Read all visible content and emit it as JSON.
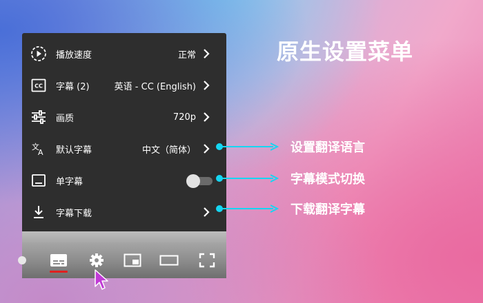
{
  "headline": "原生设置菜单",
  "menu": {
    "items": [
      {
        "icon": "playback-speed-icon",
        "label": "播放速度",
        "value": "正常"
      },
      {
        "icon": "subtitles-cc-icon",
        "label": "字幕 (2)",
        "value": "英语 - CC (English)"
      },
      {
        "icon": "quality-sliders-icon",
        "label": "画质",
        "value": "720p"
      },
      {
        "icon": "translate-icon",
        "label": "默认字幕",
        "value": "中文（简体）"
      },
      {
        "icon": "single-subtitle-icon",
        "label": "单字幕",
        "toggle_on": false
      },
      {
        "icon": "download-icon",
        "label": "字幕下载"
      }
    ]
  },
  "callouts": [
    {
      "text": "设置翻译语言"
    },
    {
      "text": "字幕模式切换"
    },
    {
      "text": "下载翻译字幕"
    }
  ],
  "controls": [
    "subtitles-icon",
    "settings-gear-icon",
    "miniplayer-icon",
    "theater-mode-icon",
    "fullscreen-icon"
  ],
  "colors": {
    "callout": "#15d6f2",
    "menu_bg": "#2e2e2e",
    "cc_active": "#e0201f"
  }
}
